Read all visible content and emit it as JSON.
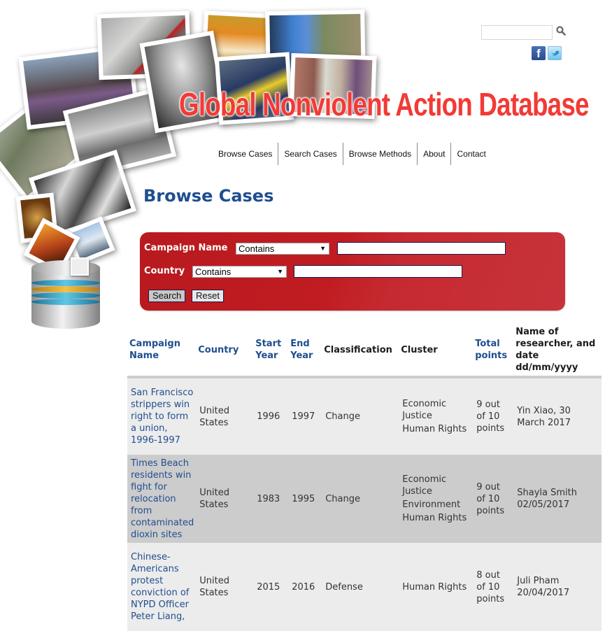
{
  "header": {
    "site_title": "Global Nonviolent Action Database",
    "search_placeholder": "",
    "search_value": "",
    "icons": [
      "search-icon",
      "facebook-icon",
      "twitter-icon"
    ],
    "facebook_glyph": "f"
  },
  "nav": {
    "items": [
      {
        "label": "Browse Cases"
      },
      {
        "label": "Search Cases"
      },
      {
        "label": "Browse Methods"
      },
      {
        "label": "About"
      },
      {
        "label": "Contact"
      }
    ]
  },
  "page": {
    "title": "Browse Cases"
  },
  "search_form": {
    "campaign_name_label": "Campaign Name",
    "campaign_name_operator": "Contains",
    "campaign_name_value": "",
    "country_label": "Country",
    "country_operator": "Contains",
    "country_value": "",
    "search_button": "Search",
    "reset_button": "Reset",
    "dropdown_arrow": "▼"
  },
  "table": {
    "headers": {
      "campaign_name": "Campaign Name",
      "country": "Country",
      "start_year": "Start Year",
      "end_year": "End Year",
      "classification": "Classification",
      "cluster": "Cluster",
      "total_points": "Total points",
      "researcher": "Name of researcher, and date dd/mm/yyyy"
    },
    "rows": [
      {
        "campaign_name": "San Francisco strippers win right to form a union, 1996-1997",
        "country": "United States",
        "start_year": "1996",
        "end_year": "1997",
        "classification": "Change",
        "clusters": [
          "Economic Justice",
          "Human Rights"
        ],
        "total_points": "9 out of 10 points",
        "researcher": "Yin Xiao, 30 March 2017"
      },
      {
        "campaign_name": "Times Beach residents win fight for relocation from contaminated dioxin sites",
        "country": "United States",
        "start_year": "1983",
        "end_year": "1995",
        "classification": "Change",
        "clusters": [
          "Economic Justice",
          "Environment",
          "Human Rights"
        ],
        "total_points": "9 out of 10 points",
        "researcher": "Shayla Smith 02/05/2017"
      },
      {
        "campaign_name": "Chinese-Americans protest conviction of NYPD Officer Peter Liang,",
        "country": "United States",
        "start_year": "2015",
        "end_year": "2016",
        "classification": "Defense",
        "clusters": [
          "Human Rights"
        ],
        "total_points": "8 out of 10 points",
        "researcher": "Juli Pham 20/04/2017"
      }
    ]
  },
  "colors": {
    "title_red": "#f23a36",
    "link_blue": "#1f4e8f",
    "panel_red": "#c01c22",
    "row_light": "#ececec",
    "row_dark": "#cccccc"
  }
}
